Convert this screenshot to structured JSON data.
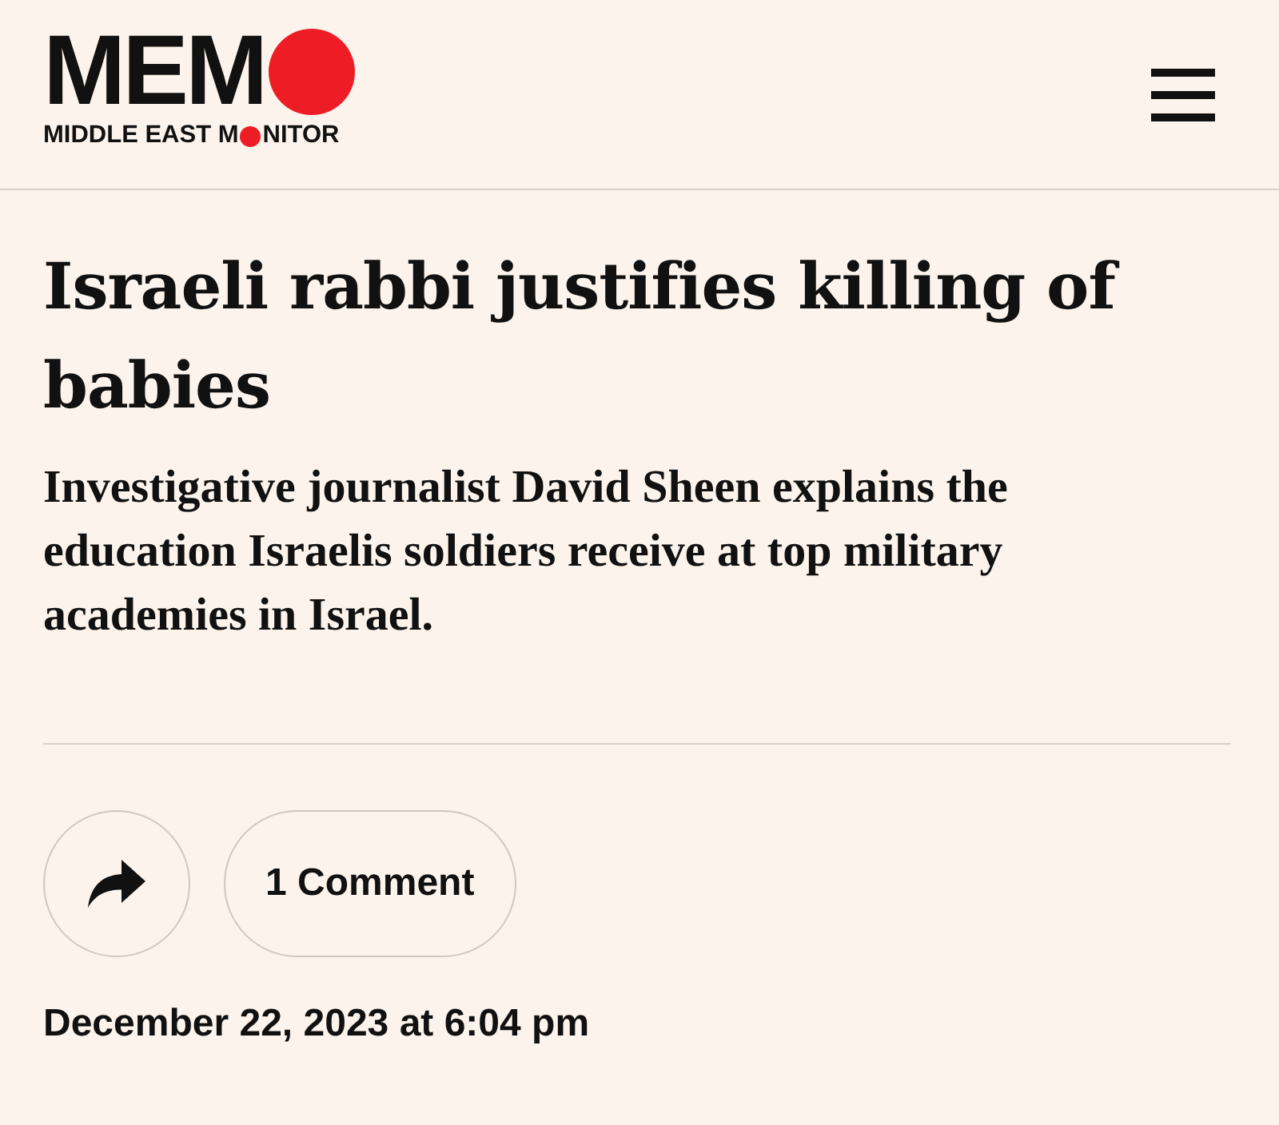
{
  "logo": {
    "letters": "MEM",
    "tagline_start": "MIDDLE EAST M",
    "tagline_end": "NITOR"
  },
  "article": {
    "headline": "Israeli rabbi justifies killing of babies",
    "standfirst": "Investigative journalist David Sheen explains the education Israelis soldiers receive at top military academies in Israel."
  },
  "actions": {
    "comments": "1 Comment"
  },
  "date": "December 22, 2023 at 6:04 pm"
}
